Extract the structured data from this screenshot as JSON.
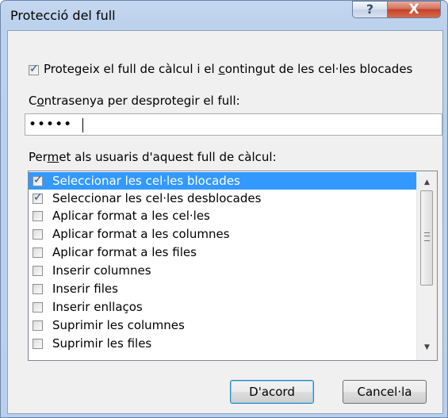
{
  "dialog": {
    "title": "Protecció del full",
    "help_glyph": "?",
    "close_glyph": "X"
  },
  "protect_checkbox": {
    "checked": true,
    "label_pre": "Protegeix el full de càlcul i el ",
    "label_accel": "c",
    "label_post": "ontingut de les cel·les blocades"
  },
  "password": {
    "label_pre": "C",
    "label_accel": "o",
    "label_post": "ntrasenya per desprotegir el full:",
    "value": "•••••"
  },
  "permissions": {
    "label_pre": "Per",
    "label_accel": "m",
    "label_post": "et als usuaris d'aquest full de càlcul:",
    "items": [
      {
        "label": "Seleccionar les cel·les blocades",
        "checked": true,
        "selected": true
      },
      {
        "label": "Seleccionar les cel·les desblocades",
        "checked": true,
        "selected": false
      },
      {
        "label": "Aplicar format a les cel·les",
        "checked": false,
        "selected": false
      },
      {
        "label": "Aplicar format a les columnes",
        "checked": false,
        "selected": false
      },
      {
        "label": "Aplicar format a les files",
        "checked": false,
        "selected": false
      },
      {
        "label": "Inserir columnes",
        "checked": false,
        "selected": false
      },
      {
        "label": "Inserir files",
        "checked": false,
        "selected": false
      },
      {
        "label": "Inserir enllaços",
        "checked": false,
        "selected": false
      },
      {
        "label": "Suprimir les columnes",
        "checked": false,
        "selected": false
      },
      {
        "label": "Suprimir les files",
        "checked": false,
        "selected": false
      }
    ]
  },
  "buttons": {
    "ok_label": "D'acord",
    "cancel_label": "Cancel·la"
  }
}
